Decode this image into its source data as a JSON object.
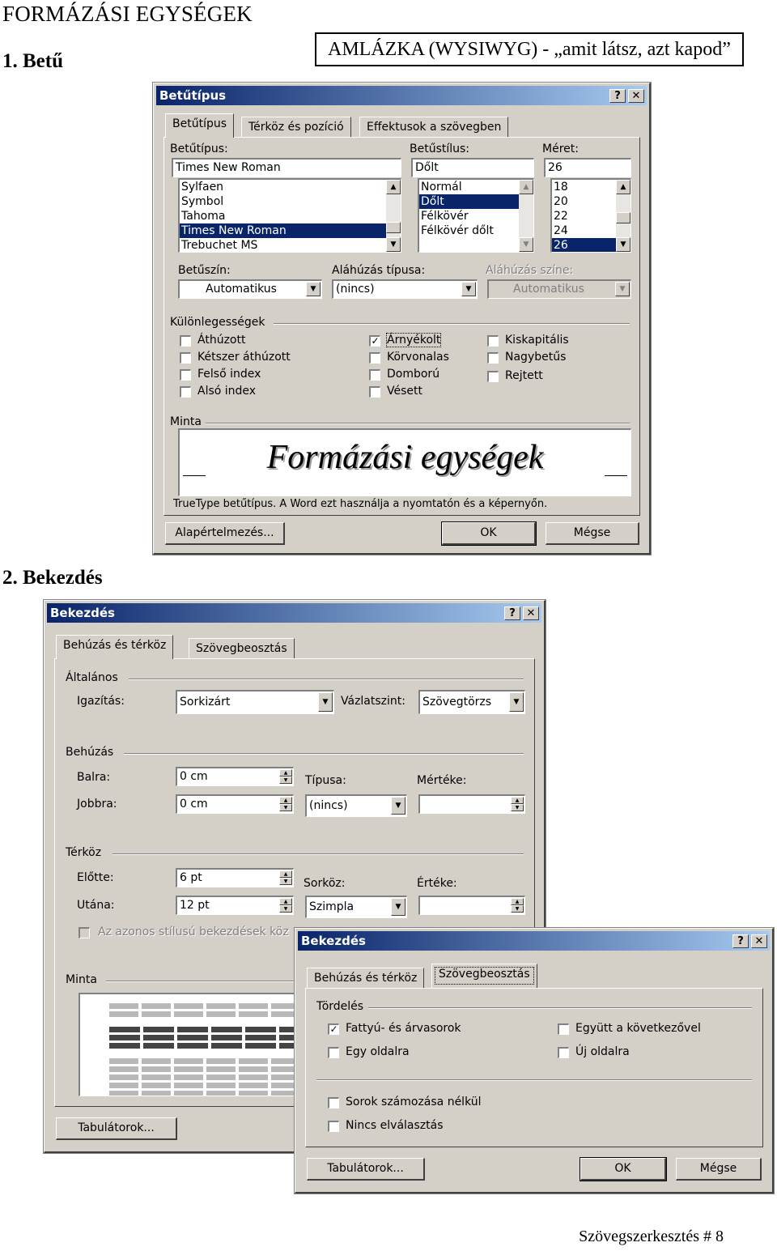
{
  "page": {
    "title": "FORMÁZÁSI EGYSÉGEK",
    "section1": "1. Betű",
    "boxed_note": "AMLÁZKA (WYSIWYG) - „amit látsz, azt kapod”",
    "section2": "2. Bekezdés",
    "footer": "Szövegszerkesztés # 8"
  },
  "font_dialog": {
    "title": "Betűtípus",
    "help": "?",
    "close": "✕",
    "tabs": [
      "Betűtípus",
      "Térköz és pozíció",
      "Effektusok a szövegben"
    ],
    "font_label": "Betűtípus:",
    "font_value": "Times New Roman",
    "font_list": [
      "Sylfaen",
      "Symbol",
      "Tahoma",
      "Times New Roman",
      "Trebuchet MS"
    ],
    "style_label": "Betűstílus:",
    "style_value": "Dőlt",
    "style_list": [
      "Normál",
      "Dőlt",
      "Félkövér",
      "Félkövér dőlt"
    ],
    "size_label": "Méret:",
    "size_value": "26",
    "size_list": [
      "18",
      "20",
      "22",
      "24",
      "26"
    ],
    "color_label": "Betűszín:",
    "color_value": "Automatikus",
    "underline_label": "Aláhúzás típusa:",
    "underline_value": "(nincs)",
    "underline_color_label": "Aláhúzás színe:",
    "underline_color_value": "Automatikus",
    "effects_label": "Különlegességek",
    "effects": [
      {
        "label": "Áthúzott",
        "checked": false
      },
      {
        "label": "Kétszer áthúzott",
        "checked": false
      },
      {
        "label": "Felső index",
        "checked": false
      },
      {
        "label": "Alsó index",
        "checked": false
      },
      {
        "label": "Árnyékolt",
        "checked": true
      },
      {
        "label": "Körvonalas",
        "checked": false
      },
      {
        "label": "Domború",
        "checked": false
      },
      {
        "label": "Vésett",
        "checked": false
      },
      {
        "label": "Kiskapitális",
        "checked": false
      },
      {
        "label": "Nagybetűs",
        "checked": false
      },
      {
        "label": "Rejtett",
        "checked": false
      }
    ],
    "preview_label": "Minta",
    "preview_text": "Formázási egységek",
    "truetype_note": "TrueType betűtípus. A Word ezt használja a nyomtatón és a képernyőn.",
    "default_button": "Alapértelmezés...",
    "ok_button": "OK",
    "cancel_button": "Mégse"
  },
  "para_dialog": {
    "title": "Bekezdés",
    "help": "?",
    "close": "✕",
    "tabs": [
      "Behúzás és térköz",
      "Szövegbeosztás"
    ],
    "general_label": "Általános",
    "alignment_label": "Igazítás:",
    "alignment_value": "Sorkizárt",
    "outline_label": "Vázlatszint:",
    "outline_value": "Szövegtörzs",
    "indent_label": "Behúzás",
    "left_label": "Balra:",
    "left_value": "0 cm",
    "right_label": "Jobbra:",
    "right_value": "0 cm",
    "special_label": "Típusa:",
    "special_value": "(nincs)",
    "by_label": "Mértéke:",
    "by_value": "",
    "spacing_label": "Térköz",
    "before_label": "Előtte:",
    "before_value": "6 pt",
    "after_label": "Utána:",
    "after_value": "12 pt",
    "line_label": "Sorköz:",
    "line_value": "Szimpla",
    "at_label": "Értéke:",
    "at_value": "",
    "same_style_label": "Az azonos stílusú bekezdések köz",
    "preview_label": "Minta",
    "tabs_button": "Tabulátorok..."
  },
  "linebreak_dialog": {
    "title": "Bekezdés",
    "help": "?",
    "close": "✕",
    "tabs": [
      "Behúzás és térköz",
      "Szövegbeosztás"
    ],
    "pagination_label": "Tördelés",
    "options": [
      {
        "label": "Fattyú- és árvasorok",
        "checked": true
      },
      {
        "label": "Egy oldalra",
        "checked": false
      },
      {
        "label": "Együtt a következővel",
        "checked": false
      },
      {
        "label": "Új oldalra",
        "checked": false
      }
    ],
    "no_line_numbers": "Sorok számozása nélkül",
    "no_hyphenation": "Nincs elválasztás",
    "tabs_button": "Tabulátorok...",
    "ok_button": "OK",
    "cancel_button": "Mégse"
  }
}
